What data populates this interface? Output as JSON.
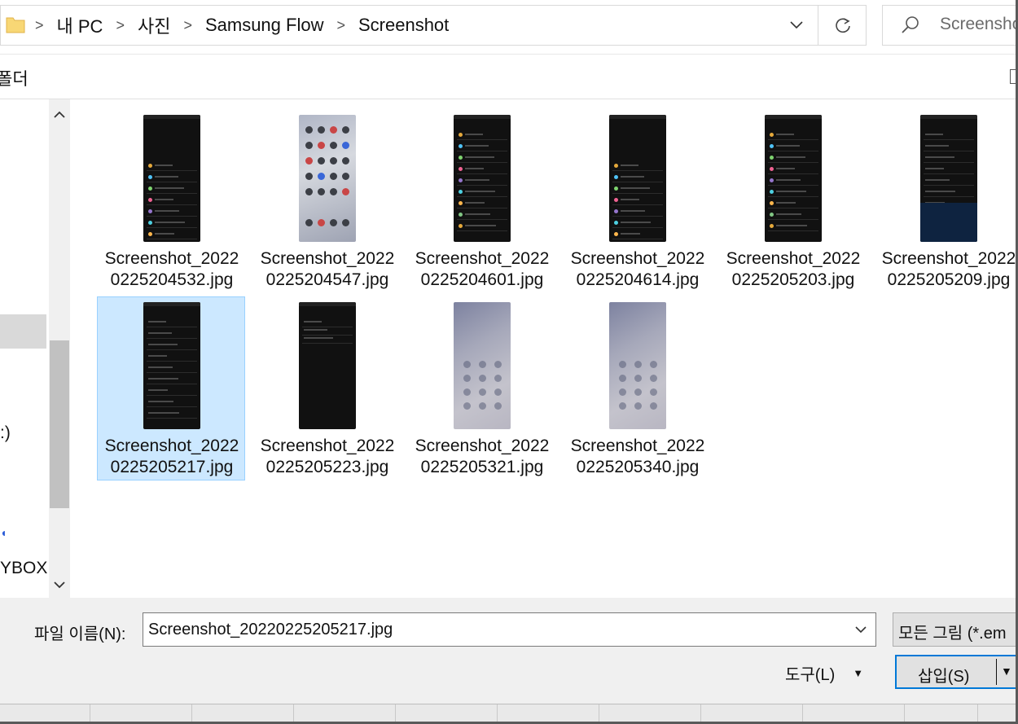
{
  "address": {
    "breadcrumbs": [
      "내 PC",
      "사진",
      "Samsung Flow",
      "Screenshot"
    ],
    "search_placeholder": "Screensho"
  },
  "toolbar": {
    "new_folder_fragment": "폴더"
  },
  "nav": {
    "fragments": [
      ":)",
      "YBOX"
    ]
  },
  "files": [
    {
      "line1": "Screenshot_2022",
      "line2": "0225204532.jpg",
      "thumb": "settings",
      "selected": false
    },
    {
      "line1": "Screenshot_2022",
      "line2": "0225204547.jpg",
      "thumb": "home",
      "selected": false
    },
    {
      "line1": "Screenshot_2022",
      "line2": "0225204601.jpg",
      "thumb": "list",
      "selected": false
    },
    {
      "line1": "Screenshot_2022",
      "line2": "0225204614.jpg",
      "thumb": "display",
      "selected": false
    },
    {
      "line1": "Screenshot_2022",
      "line2": "0225205203.jpg",
      "thumb": "list",
      "selected": false
    },
    {
      "line1": "Screenshot_2022",
      "line2": "0225205209.jpg",
      "thumb": "about",
      "selected": false
    },
    {
      "line1": "Screenshot_2022",
      "line2": "0225205217.jpg",
      "thumb": "toggles",
      "selected": true
    },
    {
      "line1": "Screenshot_2022",
      "line2": "0225205223.jpg",
      "thumb": "dialog",
      "selected": false
    },
    {
      "line1": "Screenshot_2022",
      "line2": "0225205321.jpg",
      "thumb": "lock",
      "selected": false
    },
    {
      "line1": "Screenshot_2022",
      "line2": "0225205340.jpg",
      "thumb": "lock",
      "selected": false
    }
  ],
  "bottom": {
    "filename_label": "파일 이름(N):",
    "filename_value": "Screenshot_20220225205217.jpg",
    "filter_label": "모든 그림 (*.em",
    "tools_label": "도구(L)",
    "insert_label": "삽입(S)"
  }
}
